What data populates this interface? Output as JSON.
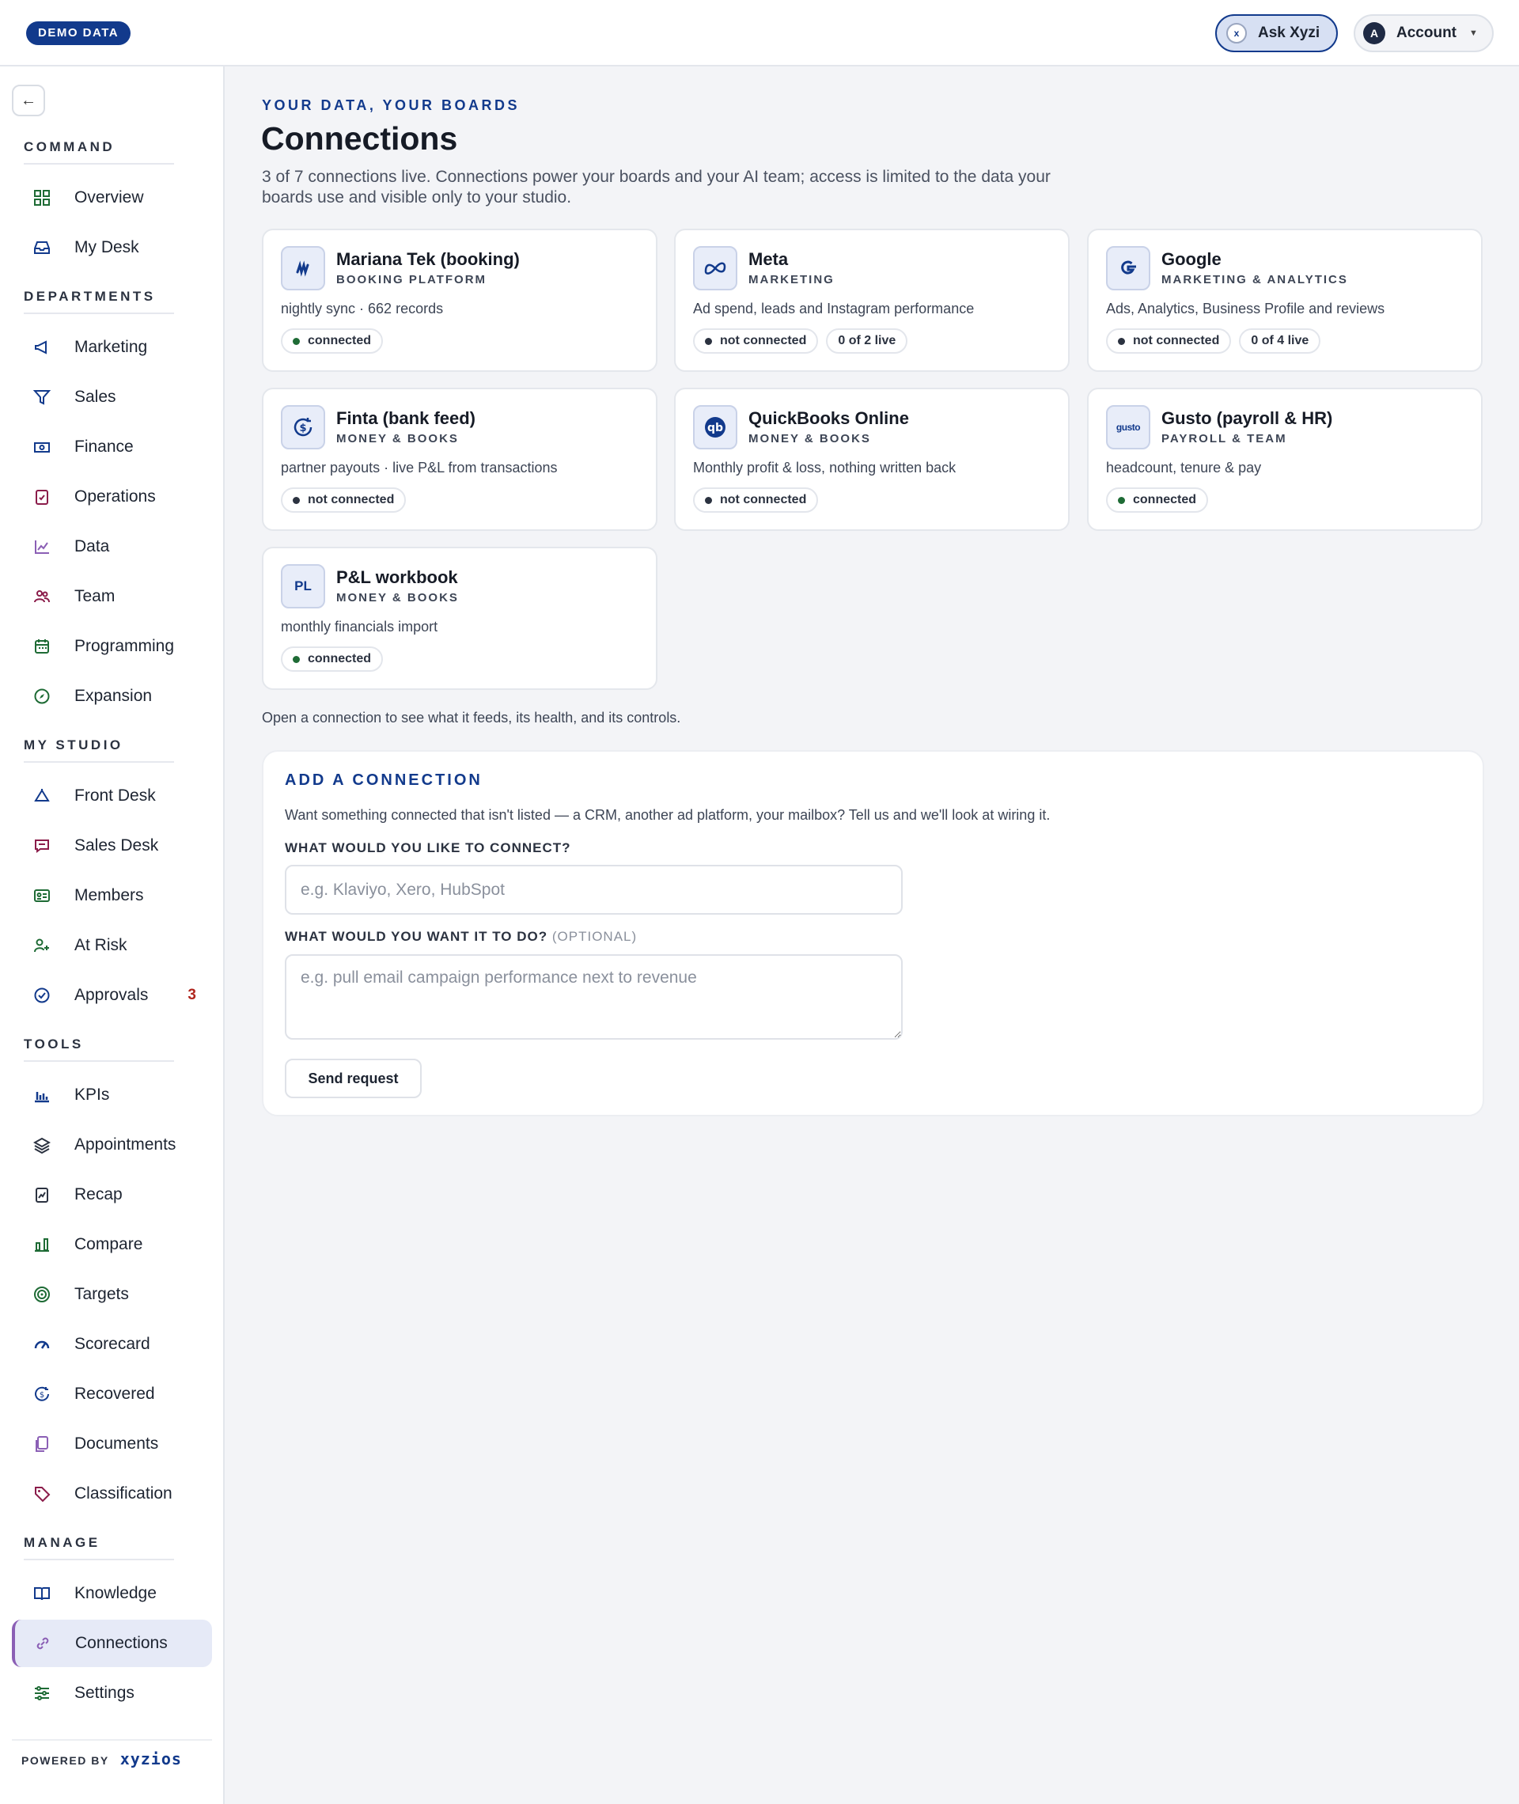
{
  "topbar": {
    "demo_badge": "DEMO DATA",
    "ask_label": "Ask Xyzi",
    "ask_icon_glyph": "x",
    "account_label": "Account",
    "account_avatar": "A"
  },
  "sidebar": {
    "sections": {
      "command": "COMMAND",
      "departments": "DEPARTMENTS",
      "my_studio": "MY STUDIO",
      "tools": "TOOLS",
      "manage": "MANAGE"
    },
    "items": {
      "overview": {
        "label": "Overview",
        "icon": "grid-icon"
      },
      "my_desk": {
        "label": "My Desk",
        "icon": "inbox-icon"
      },
      "marketing": {
        "label": "Marketing",
        "icon": "megaphone-icon"
      },
      "sales": {
        "label": "Sales",
        "icon": "funnel-icon"
      },
      "finance": {
        "label": "Finance",
        "icon": "banknote-icon"
      },
      "operations": {
        "label": "Operations",
        "icon": "clipboard-check-icon"
      },
      "data": {
        "label": "Data",
        "icon": "line-chart-icon"
      },
      "team": {
        "label": "Team",
        "icon": "users-icon"
      },
      "programming": {
        "label": "Programming",
        "icon": "calendar-icon"
      },
      "expansion": {
        "label": "Expansion",
        "icon": "compass-icon"
      },
      "front_desk": {
        "label": "Front Desk",
        "icon": "bell-icon"
      },
      "sales_desk": {
        "label": "Sales Desk",
        "icon": "chat-icon"
      },
      "members": {
        "label": "Members",
        "icon": "id-card-icon"
      },
      "at_risk": {
        "label": "At Risk",
        "icon": "user-alert-icon"
      },
      "approvals": {
        "label": "Approvals",
        "icon": "check-circle-icon",
        "count": "3"
      },
      "kpis": {
        "label": "KPIs",
        "icon": "bar-chart-icon"
      },
      "appointments": {
        "label": "Appointments",
        "icon": "layers-icon"
      },
      "recap": {
        "label": "Recap",
        "icon": "report-icon"
      },
      "compare": {
        "label": "Compare",
        "icon": "columns-chart-icon"
      },
      "targets": {
        "label": "Targets",
        "icon": "target-icon"
      },
      "scorecard": {
        "label": "Scorecard",
        "icon": "gauge-icon"
      },
      "recovered": {
        "label": "Recovered",
        "icon": "refresh-dollar-icon"
      },
      "documents": {
        "label": "Documents",
        "icon": "files-icon"
      },
      "classification": {
        "label": "Classification",
        "icon": "tag-icon"
      },
      "knowledge": {
        "label": "Knowledge",
        "icon": "book-icon"
      },
      "connections": {
        "label": "Connections",
        "icon": "link-icon"
      },
      "settings": {
        "label": "Settings",
        "icon": "sliders-icon"
      }
    },
    "powered_by": "POWERED BY",
    "brand": "xyzios"
  },
  "main": {
    "eyebrow": "YOUR DATA, YOUR BOARDS",
    "title": "Connections",
    "subtitle": "3 of 7 connections live. Connections power your boards and your AI team; access is limited to the data your boards use and visible only to your studio.",
    "hint": "Open a connection to see what it feeds, its health, and its controls."
  },
  "connections": [
    {
      "name": "Mariana Tek (booking)",
      "category": "BOOKING PLATFORM",
      "description": "nightly sync · 662 records",
      "status": "connected",
      "extra": "",
      "logo_text": "M",
      "icon": "mariana-tek-logo-icon"
    },
    {
      "name": "Meta",
      "category": "MARKETING",
      "description": "Ad spend, leads and Instagram performance",
      "status": "not connected",
      "extra": "0 of 2 live",
      "logo_text": "∞",
      "icon": "meta-logo-icon"
    },
    {
      "name": "Google",
      "category": "MARKETING & ANALYTICS",
      "description": "Ads, Analytics, Business Profile and reviews",
      "status": "not connected",
      "extra": "0 of 4 live",
      "logo_text": "G",
      "icon": "google-logo-icon"
    },
    {
      "name": "Finta (bank feed)",
      "category": "MONEY & BOOKS",
      "description": "partner payouts · live P&L from transactions",
      "status": "not connected",
      "extra": "",
      "logo_text": "$",
      "icon": "finta-logo-icon"
    },
    {
      "name": "QuickBooks Online",
      "category": "MONEY & BOOKS",
      "description": "Monthly profit & loss, nothing written back",
      "status": "not connected",
      "extra": "",
      "logo_text": "qb",
      "icon": "quickbooks-logo-icon"
    },
    {
      "name": "Gusto (payroll & HR)",
      "category": "PAYROLL & TEAM",
      "description": "headcount, tenure & pay",
      "status": "connected",
      "extra": "",
      "logo_text": "gusto",
      "icon": "gusto-logo-icon"
    },
    {
      "name": "P&L workbook",
      "category": "MONEY & BOOKS",
      "description": "monthly financials import",
      "status": "connected",
      "extra": "",
      "logo_text": "PL",
      "icon": "workbook-logo-icon"
    }
  ],
  "add_connection": {
    "title": "ADD A CONNECTION",
    "lead": "Want something connected that isn't listed — a CRM, another ad platform, your mailbox? Tell us and we'll look at wiring it.",
    "q1_label": "WHAT WOULD YOU LIKE TO CONNECT?",
    "q1_placeholder": "e.g. Klaviyo, Xero, HubSpot",
    "q2_label": "WHAT WOULD YOU WANT IT TO DO?",
    "q2_optional": "(OPTIONAL)",
    "q2_placeholder": "e.g. pull email campaign performance next to revenue",
    "send_label": "Send request"
  },
  "colors": {
    "brand": "#123a8c",
    "connected_dot": "#1e6b35",
    "not_connected_dot": "#2b3240",
    "alert": "#b0261e",
    "active_accent": "#8b5fb5"
  }
}
